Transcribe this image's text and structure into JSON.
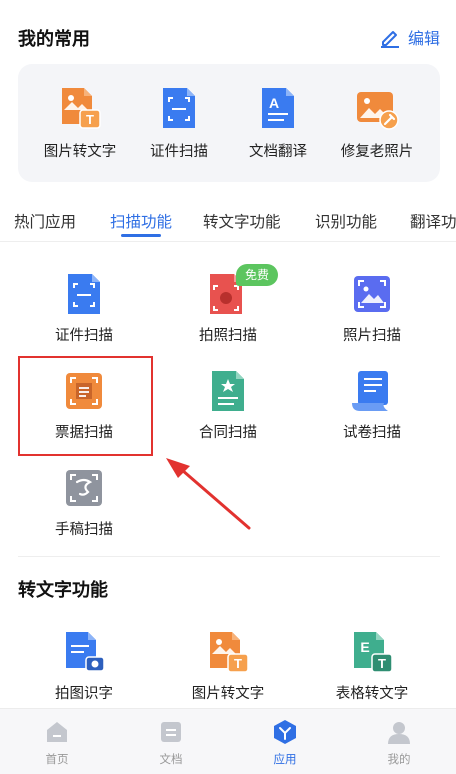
{
  "favorites": {
    "title": "我的常用",
    "edit_label": "编辑",
    "items": [
      {
        "label": "图片转文字",
        "icon": "image-to-text-icon"
      },
      {
        "label": "证件扫描",
        "icon": "id-scan-icon"
      },
      {
        "label": "文档翻译",
        "icon": "doc-translate-icon"
      },
      {
        "label": "修复老照片",
        "icon": "photo-restore-icon"
      }
    ]
  },
  "tabs": [
    "热门应用",
    "扫描功能",
    "转文字功能",
    "识别功能",
    "翻译功"
  ],
  "active_tab": "扫描功能",
  "scan_section": {
    "items": [
      {
        "label": "证件扫描",
        "icon": "id-scan-icon"
      },
      {
        "label": "拍照扫描",
        "icon": "camera-scan-icon",
        "badge": "免费"
      },
      {
        "label": "照片扫描",
        "icon": "photo-scan-icon"
      },
      {
        "label": "票据扫描",
        "icon": "receipt-scan-icon"
      },
      {
        "label": "合同扫描",
        "icon": "contract-scan-icon"
      },
      {
        "label": "试卷扫描",
        "icon": "exam-scan-icon"
      },
      {
        "label": "手稿扫描",
        "icon": "manuscript-scan-icon"
      }
    ]
  },
  "text_section": {
    "title": "转文字功能",
    "items": [
      {
        "label": "拍图识字",
        "icon": "photo-ocr-icon"
      },
      {
        "label": "图片转文字",
        "icon": "image-to-text-icon"
      },
      {
        "label": "表格转文字",
        "icon": "table-to-text-icon"
      }
    ]
  },
  "bottom_nav": [
    {
      "label": "首页",
      "icon": "home-icon"
    },
    {
      "label": "文档",
      "icon": "document-icon"
    },
    {
      "label": "应用",
      "icon": "apps-icon",
      "active": true
    },
    {
      "label": "我的",
      "icon": "profile-icon"
    }
  ],
  "colors": {
    "accent": "#2f6fe4",
    "highlight": "#e2322f",
    "badge": "#5cc55f"
  }
}
